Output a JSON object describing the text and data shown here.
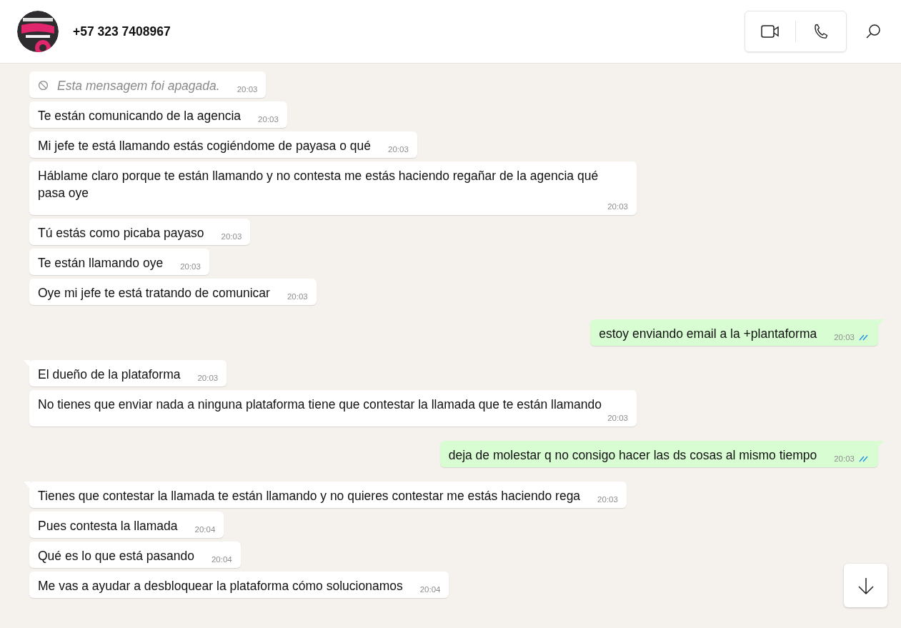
{
  "header": {
    "contact_name": "+57 323 7408967"
  },
  "messages": [
    {
      "kind": "deleted",
      "outgoing": false,
      "tail": false,
      "text": "Esta mensagem foi apagada.",
      "time": "20:03"
    },
    {
      "kind": "text",
      "outgoing": false,
      "tail": false,
      "text": "Te están comunicando de la agencia",
      "time": "20:03"
    },
    {
      "kind": "text",
      "outgoing": false,
      "tail": false,
      "text": "Mi jefe te está llamando estás cogiéndome de payasa o qué",
      "time": "20:03"
    },
    {
      "kind": "text",
      "outgoing": false,
      "tail": false,
      "text": "Háblame claro porque te están llamando y no contesta me estás haciendo regañar de la agencia qué pasa oye",
      "time": "20:03"
    },
    {
      "kind": "text",
      "outgoing": false,
      "tail": false,
      "text": "Tú estás como picaba payaso",
      "time": "20:03"
    },
    {
      "kind": "text",
      "outgoing": false,
      "tail": false,
      "text": "Te están llamando oye",
      "time": "20:03"
    },
    {
      "kind": "text",
      "outgoing": false,
      "tail": false,
      "text": "Oye mi jefe te está tratando de comunicar",
      "time": "20:03"
    },
    {
      "kind": "text",
      "outgoing": true,
      "tail": true,
      "text": "estoy enviando email a la +plantaforma",
      "time": "20:03",
      "read": true
    },
    {
      "kind": "text",
      "outgoing": false,
      "tail": true,
      "text": "El dueño de la plataforma",
      "time": "20:03"
    },
    {
      "kind": "text",
      "outgoing": false,
      "tail": false,
      "text": "No tienes que enviar nada a ninguna plataforma tiene que contestar la llamada que te están llamando",
      "time": "20:03"
    },
    {
      "kind": "text",
      "outgoing": true,
      "tail": true,
      "text": "deja de molestar q no consigo hacer las ds cosas al mismo tiempo",
      "time": "20:03",
      "read": true
    },
    {
      "kind": "text",
      "outgoing": false,
      "tail": true,
      "text": "Tienes que contestar la llamada te están llamando y no quieres contestar me estás haciendo rega",
      "time": "20:03"
    },
    {
      "kind": "text",
      "outgoing": false,
      "tail": false,
      "text": "Pues contesta la llamada",
      "time": "20:04"
    },
    {
      "kind": "text",
      "outgoing": false,
      "tail": false,
      "text": "Qué es lo que está pasando",
      "time": "20:04"
    },
    {
      "kind": "text",
      "outgoing": false,
      "tail": false,
      "text": "Me vas a ayudar a desbloquear la plataforma cómo solucionamos",
      "time": "20:04"
    }
  ]
}
